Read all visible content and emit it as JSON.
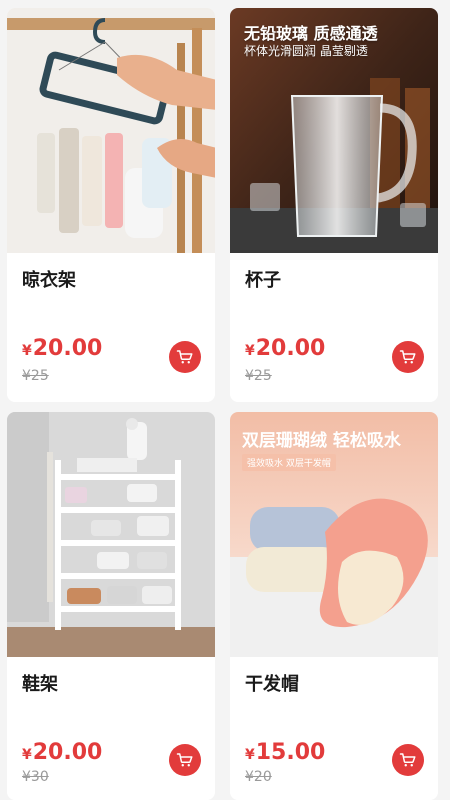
{
  "products": [
    {
      "title": "晾衣架",
      "currency": "¥",
      "price": "20.00",
      "original_price": "¥25",
      "image": "clothes-hanger-photo"
    },
    {
      "title": "杯子",
      "currency": "¥",
      "price": "20.00",
      "original_price": "¥25",
      "image": "glass-mug-photo",
      "banner": {
        "headline": "无铅玻璃 质感通透",
        "subline": "杯体光滑圆润 晶莹剔透"
      }
    },
    {
      "title": "鞋架",
      "currency": "¥",
      "price": "20.00",
      "original_price": "¥30",
      "image": "shoe-rack-photo"
    },
    {
      "title": "干发帽",
      "currency": "¥",
      "price": "15.00",
      "original_price": "¥20",
      "image": "hair-towel-photo",
      "banner": {
        "headline": "双层珊瑚绒 轻松吸水",
        "subline": "强效吸水 双层干发帽"
      }
    }
  ],
  "colors": {
    "accent": "#e23b3b",
    "muted": "#9a9a9a",
    "background": "#f4f4f4"
  },
  "icons": {
    "cart": "shopping-cart-icon"
  }
}
